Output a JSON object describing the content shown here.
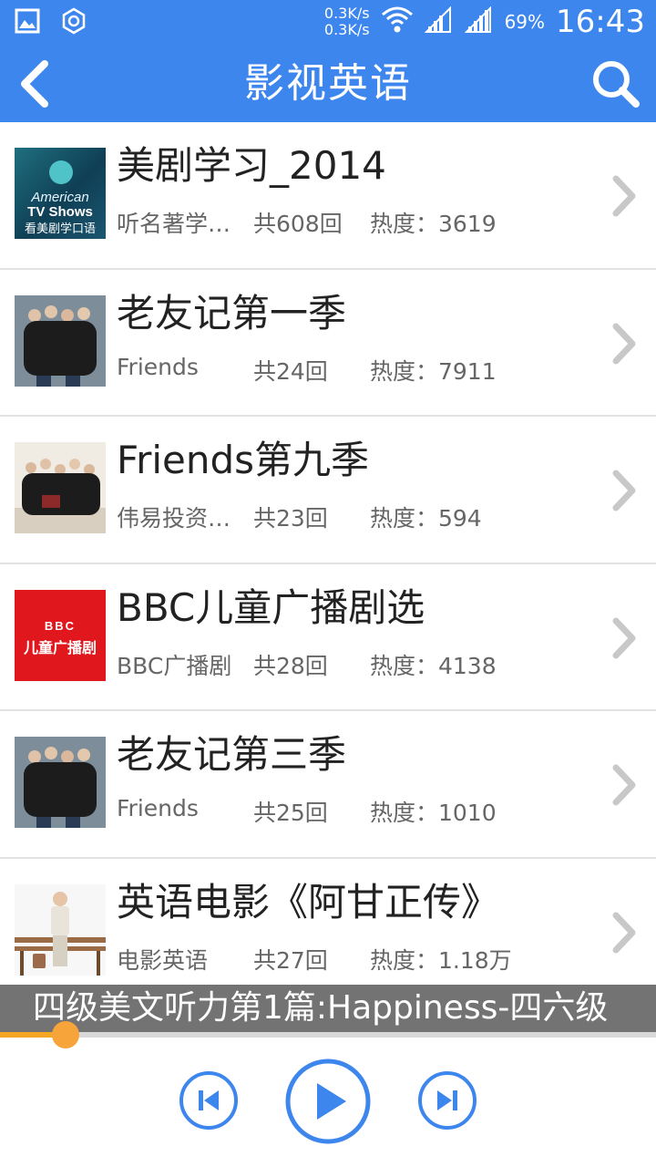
{
  "status_bar": {
    "net_speed_up": "0.3K/s",
    "net_speed_down": "0.3K/s",
    "battery": "69%",
    "time": "16:43",
    "icons": [
      "gallery-icon",
      "settings-hex-icon",
      "wifi-icon",
      "signal-1-icon",
      "signal-2-icon"
    ]
  },
  "header": {
    "title": "影视英语",
    "back_icon": "chevron-left-icon",
    "search_icon": "search-icon"
  },
  "items": [
    {
      "title": "美剧学习_2014",
      "source": "听名著学…",
      "count": "共608回",
      "heat": "热度：3619",
      "thumb_text_1": "American",
      "thumb_text_2": "TV Shows",
      "thumb_text_3": "看美剧学口语"
    },
    {
      "title": "老友记第一季",
      "source": "Friends",
      "count": "共24回",
      "heat": "热度：7911"
    },
    {
      "title": "Friends第九季",
      "source": "伟易投资…",
      "count": "共23回",
      "heat": "热度：594"
    },
    {
      "title": "BBC儿童广播剧选",
      "source": "BBC广播剧",
      "count": "共28回",
      "heat": "热度：4138",
      "thumb_text_1": "BBC",
      "thumb_text_2": "儿童广播剧"
    },
    {
      "title": "老友记第三季",
      "source": "Friends",
      "count": "共25回",
      "heat": "热度：1010"
    },
    {
      "title": "英语电影《阿甘正传》",
      "source": "电影英语",
      "count": "共27回",
      "heat": "热度：1.18万"
    }
  ],
  "player": {
    "now_playing": "四级美文听力第1篇:Happiness-四六级",
    "progress": 0.1,
    "colors": {
      "accent": "#3d86ee",
      "progress": "#f5a623"
    }
  }
}
